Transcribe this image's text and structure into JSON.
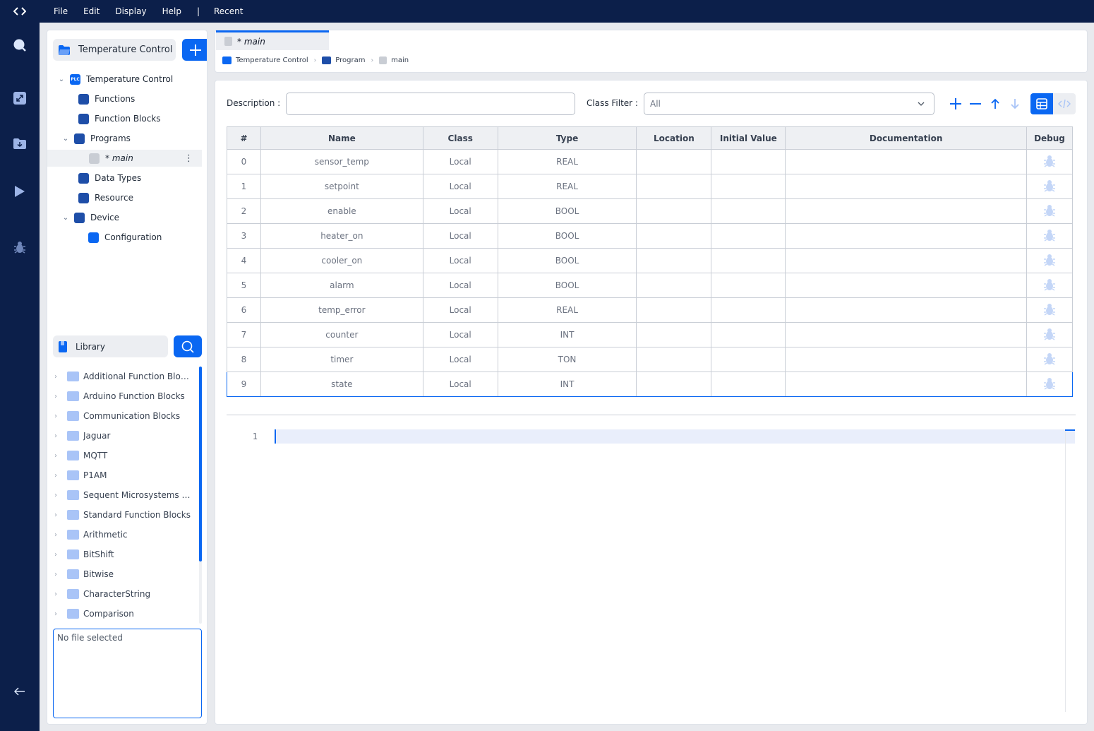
{
  "menu": {
    "items": [
      "File",
      "Edit",
      "Display",
      "Help"
    ],
    "separator": "|",
    "recent": "Recent"
  },
  "rail": {
    "icons": [
      "search-icon",
      "expand-icon",
      "download-icon",
      "play-icon",
      "debug-icon",
      "back-arrow-icon"
    ]
  },
  "project": {
    "title": "Temperature Control",
    "tree": [
      {
        "label": "Temperature Control",
        "icon": "plc-icon",
        "expanded": true,
        "level": 0
      },
      {
        "label": "Functions",
        "icon": "functions-icon",
        "level": 1
      },
      {
        "label": "Function Blocks",
        "icon": "function-blocks-icon",
        "level": 1
      },
      {
        "label": "Programs",
        "icon": "programs-icon",
        "expanded": true,
        "level": 1
      },
      {
        "label": "* main",
        "icon": "file-icon",
        "level": 2,
        "selected": true
      },
      {
        "label": "Data Types",
        "icon": "data-types-icon",
        "level": 1
      },
      {
        "label": "Resource",
        "icon": "resource-icon",
        "level": 1
      },
      {
        "label": "Device",
        "icon": "device-icon",
        "expanded": true,
        "level": 1
      },
      {
        "label": "Configuration",
        "icon": "configuration-icon",
        "level": 2
      }
    ],
    "plc_badge": "PLC"
  },
  "library": {
    "title": "Library",
    "items": [
      "Additional Function Blocks",
      "Arduino Function Blocks",
      "Communication Blocks",
      "Jaguar",
      "MQTT",
      "P1AM",
      "Sequent Microsystems Mo...",
      "Standard Function Blocks",
      "Arithmetic",
      "BitShift",
      "Bitwise",
      "CharacterString",
      "Comparison"
    ],
    "file_box": "No file selected"
  },
  "tab": {
    "label": "* main"
  },
  "breadcrumb": [
    "Temperature Control",
    "Program",
    "main"
  ],
  "editor": {
    "description_label": "Description :",
    "description_value": "",
    "class_filter_label": "Class Filter :",
    "class_filter_value": "All",
    "columns": [
      "#",
      "Name",
      "Class",
      "Type",
      "Location",
      "Initial Value",
      "Documentation",
      "Debug"
    ],
    "rows": [
      {
        "idx": "0",
        "name": "sensor_temp",
        "class": "Local",
        "type": "REAL",
        "location": "",
        "initial": "",
        "doc": ""
      },
      {
        "idx": "1",
        "name": "setpoint",
        "class": "Local",
        "type": "REAL",
        "location": "",
        "initial": "",
        "doc": ""
      },
      {
        "idx": "2",
        "name": "enable",
        "class": "Local",
        "type": "BOOL",
        "location": "",
        "initial": "",
        "doc": ""
      },
      {
        "idx": "3",
        "name": "heater_on",
        "class": "Local",
        "type": "BOOL",
        "location": "",
        "initial": "",
        "doc": ""
      },
      {
        "idx": "4",
        "name": "cooler_on",
        "class": "Local",
        "type": "BOOL",
        "location": "",
        "initial": "",
        "doc": ""
      },
      {
        "idx": "5",
        "name": "alarm",
        "class": "Local",
        "type": "BOOL",
        "location": "",
        "initial": "",
        "doc": ""
      },
      {
        "idx": "6",
        "name": "temp_error",
        "class": "Local",
        "type": "REAL",
        "location": "",
        "initial": "",
        "doc": ""
      },
      {
        "idx": "7",
        "name": "counter",
        "class": "Local",
        "type": "INT",
        "location": "",
        "initial": "",
        "doc": ""
      },
      {
        "idx": "8",
        "name": "timer",
        "class": "Local",
        "type": "TON",
        "location": "",
        "initial": "",
        "doc": ""
      },
      {
        "idx": "9",
        "name": "state",
        "class": "Local",
        "type": "INT",
        "location": "",
        "initial": "",
        "doc": "",
        "selected": true
      }
    ],
    "code_line_number": "1"
  },
  "colors": {
    "nav": "#0c1f4a",
    "accent": "#0a67f2",
    "panel": "#ffffff",
    "background": "#e8eaee"
  }
}
